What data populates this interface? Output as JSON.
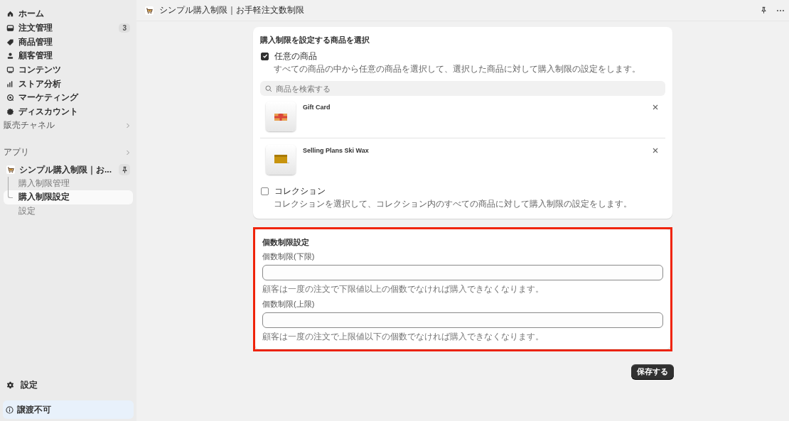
{
  "sidebar": {
    "nav_items": [
      {
        "label": "ホーム",
        "selected": false
      },
      {
        "label": "注文管理",
        "badge": "3",
        "selected": false
      },
      {
        "label": "商品管理",
        "selected": false
      },
      {
        "label": "顧客管理",
        "selected": false
      },
      {
        "label": "コンテンツ",
        "selected": false
      },
      {
        "label": "ストア分析",
        "selected": false
      },
      {
        "label": "マーケティング",
        "selected": false
      },
      {
        "label": "ディスカウント",
        "selected": false
      }
    ],
    "sections": [
      {
        "label": "販売チャネル"
      },
      {
        "label": "アプリ"
      }
    ],
    "app": {
      "name": "シンプル購入制限｜お...",
      "sub_items": [
        {
          "label": "購入制限管理",
          "selected": false
        },
        {
          "label": "購入制限設定",
          "selected": true
        },
        {
          "label": "設定",
          "selected": false
        }
      ]
    },
    "settings": {
      "label": "設定"
    },
    "notice": {
      "label": "譲渡不可"
    }
  },
  "topbar": {
    "title": "シンプル購入制限｜お手軽注文数制限"
  },
  "product_card": {
    "title": "購入制限を設定する商品を選択",
    "options": [
      {
        "kind": "products",
        "label": "任意の商品",
        "description": "すべての商品の中から任意の商品を選択して、選択した商品に対して購入制限の設定をします。",
        "checked": true
      },
      {
        "kind": "collections",
        "label": "コレクション",
        "description": "コレクションを選択して、コレクション内のすべての商品に対して購入制限の設定をします。",
        "checked": false
      }
    ],
    "search": {
      "placeholder": "商品を検索する"
    },
    "products": [
      {
        "name": "Gift Card",
        "kind": "picture"
      },
      {
        "name": "Selling Plans Ski Wax",
        "kind": "picture"
      }
    ]
  },
  "limit_card": {
    "title": "個数制限設定",
    "highlighted": true,
    "fields": [
      {
        "label": "個数制限(下限)",
        "help": "顧客は一度の注文で下限値以上の個数でなければ購入できなくなります。"
      },
      {
        "label": "個数制限(上限)",
        "help": "顧客は一度の注文で上限値以下の個数でなければ購入できなくなります。"
      }
    ]
  },
  "save_button": {
    "label": "保存する"
  }
}
